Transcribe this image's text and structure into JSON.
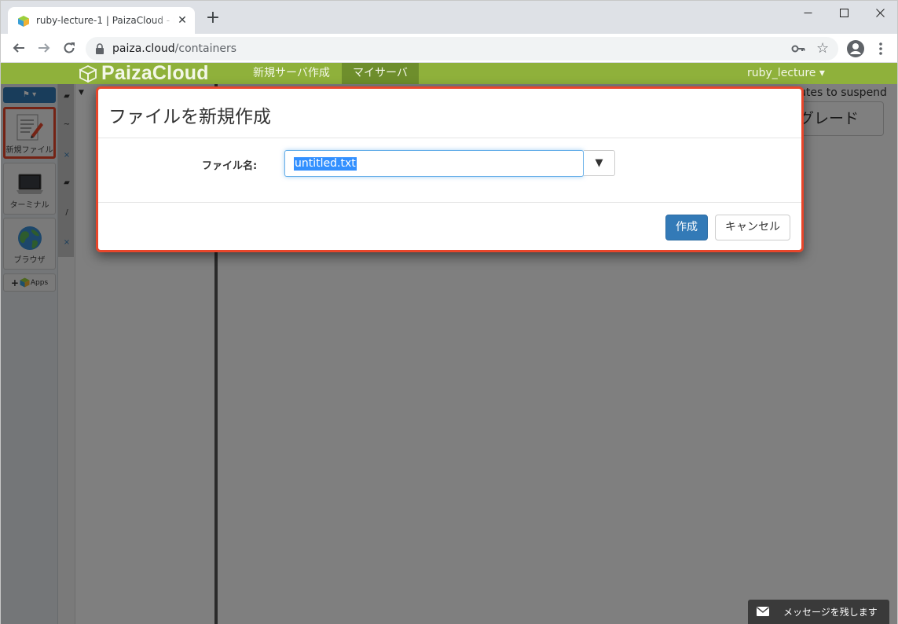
{
  "browser": {
    "tab_title": "ruby-lecture-1 | PaizaCloud - Inst",
    "tab_close": "✕",
    "new_tab": "+",
    "url_host": "paiza.cloud",
    "url_path": "/containers"
  },
  "header": {
    "logo": "PaizaCloud",
    "nav_new_server": "新規サーバ作成",
    "nav_my_server": "マイサーバ",
    "user": "ruby_lecture"
  },
  "sidebar": {
    "new_file": "新規ファイル",
    "terminal": "ターミナル",
    "browser": "ブラウザ",
    "apps": "Apps"
  },
  "workspace": {
    "suspend_text": "utes to suspend",
    "upgrade_label": "プグレード"
  },
  "dialog": {
    "title": "ファイルを新規作成",
    "filename_label": "ファイル名:",
    "filename_value": "untitled.txt",
    "dropdown_arrow": "▼",
    "create_button": "作成",
    "cancel_button": "キャンセル"
  },
  "feedback": {
    "message_label": "メッセージを残します"
  },
  "colors": {
    "header_green": "#8fb13b",
    "highlight_red": "#e8462b",
    "primary_blue": "#337ab7"
  }
}
